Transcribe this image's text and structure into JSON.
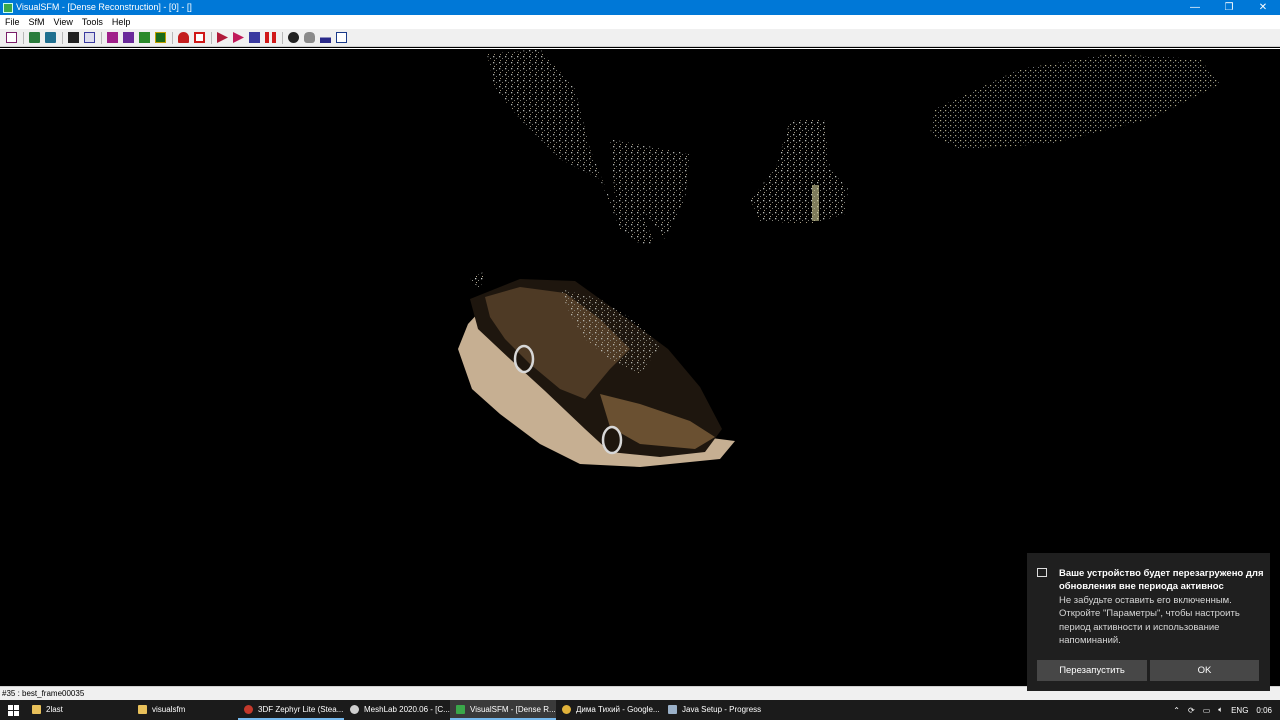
{
  "window": {
    "title": "VisualSFM - [Dense Reconstruction] - [0] - []",
    "minimize_glyph": "—",
    "maximize_glyph": "❐",
    "close_glyph": "✕"
  },
  "menu": [
    "File",
    "SfM",
    "View",
    "Tools",
    "Help"
  ],
  "toolbar": {
    "icons": [
      "log-window-icon",
      "open-multi-images-icon",
      "open-nvm-icon",
      "save-icon",
      "copy-icon",
      "match-images-icon",
      "compute-missing-match-icon",
      "pairwise-match-icon",
      "view-matches-icon",
      "remove-icon",
      "delete-icon",
      "reconstruct-sparse-icon",
      "reconstruct-dense-icon",
      "run-dense-icon",
      "pause-icon",
      "settings-gear-icon",
      "hand-pan-icon",
      "bars-icon",
      "window-icon"
    ]
  },
  "status_bar": {
    "text": "#35 : best_frame00035"
  },
  "taskbar": {
    "items": [
      {
        "label": "2last",
        "icon": "folder-icon",
        "color": "#e8c05a",
        "state": "normal"
      },
      {
        "label": "visualsfm",
        "icon": "folder-icon",
        "color": "#e8c05a",
        "state": "normal"
      },
      {
        "label": "3DF Zephyr Lite (Stea...",
        "icon": "zephyr-app-icon",
        "color": "#c4392b",
        "state": "running"
      },
      {
        "label": "MeshLab 2020.06 - [C...",
        "icon": "meshlab-app-icon",
        "color": "#cfcfcf",
        "state": "normal"
      },
      {
        "label": "VisualSFM - [Dense R...",
        "icon": "visualsfm-app-icon",
        "color": "#3aa84a",
        "state": "active"
      },
      {
        "label": "Дима Тихий - Google...",
        "icon": "chrome-app-icon",
        "color": "#e0b23a",
        "state": "normal"
      },
      {
        "label": "Java Setup - Progress",
        "icon": "java-app-icon",
        "color": "#9ab0c8",
        "state": "normal"
      }
    ],
    "tray": {
      "language": "ENG",
      "time": "0:06"
    }
  },
  "notification": {
    "title": "Ваше устройство будет перезагружено для обновления вне периода активнос",
    "body": "Не забудьте оставить его включенным. Откройте \"Параметры\", чтобы настроить период активности и использование напоминаний.",
    "restart_label": "Перезапустить",
    "ok_label": "OK"
  },
  "colors": {
    "titlebar": "#0078d7",
    "viewport": "#000000",
    "toast_bg": "#1f1f1f",
    "toast_button": "#474747",
    "taskbar": "#1b1b1b",
    "active_task_indicator": "#76b9ed"
  }
}
